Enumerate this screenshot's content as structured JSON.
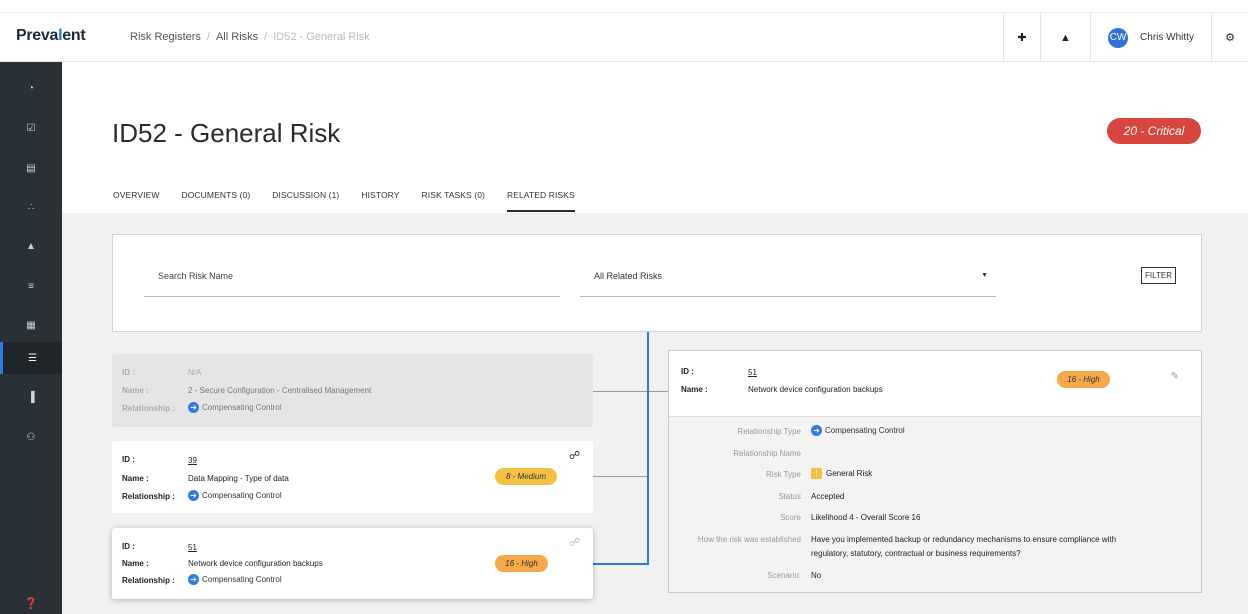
{
  "brand": {
    "pre": "Preva",
    "accent": "l",
    "post": "ent"
  },
  "breadcrumbs": [
    "Risk Registers",
    "All Risks",
    "ID52 - General Risk"
  ],
  "topbar": {
    "user_initials": "CW",
    "user_name": "Chris Whitty"
  },
  "sidebar_items": [
    {
      "icon": "dashboard-icon",
      "glyph": "◔"
    },
    {
      "icon": "check-square-icon",
      "glyph": "☑"
    },
    {
      "icon": "document-icon",
      "glyph": "▤"
    },
    {
      "icon": "sitemap-icon",
      "glyph": "∴"
    },
    {
      "icon": "warning-icon",
      "glyph": "▲"
    },
    {
      "icon": "task-list-icon",
      "glyph": "≡"
    },
    {
      "icon": "calendar-icon",
      "glyph": "▦"
    },
    {
      "icon": "list-icon",
      "glyph": "☰",
      "active": true
    },
    {
      "icon": "bar-chart-icon",
      "glyph": "▐"
    },
    {
      "icon": "users-icon",
      "glyph": "⚇"
    }
  ],
  "page": {
    "title": "ID52 - General Risk",
    "score_badge": "20 - Critical",
    "tabs": [
      "OVERVIEW",
      "DOCUMENTS (0)",
      "DISCUSSION (1)",
      "HISTORY",
      "RISK TASKS (0)",
      "RELATED RISKS"
    ],
    "active_tab": "RELATED RISKS"
  },
  "filter": {
    "search_placeholder": "Search Risk Name",
    "select_value": "All Related Risks",
    "button_label": "FILTER"
  },
  "labels": {
    "id": "ID :",
    "name": "Name :",
    "relationship": "Relationship :"
  },
  "cards": [
    {
      "id": "N/A",
      "name": "2 - Secure Configuration - Centralised Management",
      "relationship": "Compensating Control",
      "score": "",
      "state": "disabled"
    },
    {
      "id": "39",
      "name": "Data Mapping - Type of data",
      "relationship": "Compensating Control",
      "score": "8 - Medium",
      "state": "normal"
    },
    {
      "id": "51",
      "name": "Network device configuration backups",
      "relationship": "Compensating Control",
      "score": "16 - High",
      "state": "selected"
    }
  ],
  "detail": {
    "id_label": "ID :",
    "name_label": "Name :",
    "id": "51",
    "name": "Network device configuration backups",
    "score": "16 - High",
    "fields": [
      {
        "label": "Relationship Type",
        "value": "Compensating Control"
      },
      {
        "label": "Relationship Name",
        "value": ""
      },
      {
        "label": "Risk Type",
        "value": "General Risk"
      },
      {
        "label": "Status",
        "value": "Accepted"
      },
      {
        "label": "Score",
        "value": "Likelihood 4 - Overall Score 16"
      },
      {
        "label": "How the risk was established",
        "value": "Have you implemented backup or redundancy mechanisms to ensure compliance with",
        "value2": "regulatory, statutory, contractual or business requirements?"
      },
      {
        "label": "Scenario:",
        "value": "No"
      }
    ]
  },
  "colors": {
    "critical": "#d9463f",
    "medium": "#f6c143",
    "high": "#f5a94b",
    "accent": "#2f7be5",
    "sidebar": "#2a3136"
  }
}
